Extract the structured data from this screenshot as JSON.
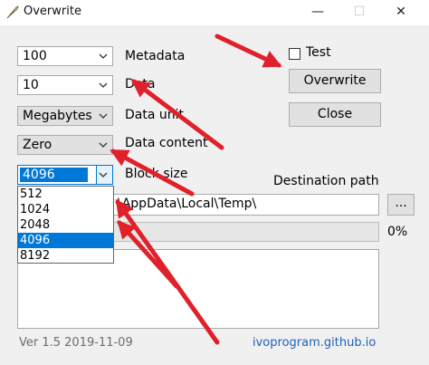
{
  "window": {
    "title": "Overwrite",
    "minimize": "—",
    "maximize": "☐",
    "close": "✕"
  },
  "metadata": {
    "value": "100",
    "label": "Metadata"
  },
  "data": {
    "value": "10",
    "label": "Data"
  },
  "data_unit": {
    "value": "Megabytes",
    "label": "Data unit"
  },
  "data_content": {
    "value": "Zero",
    "label": "Data content"
  },
  "block_size": {
    "value": "4096",
    "label": "Block size",
    "options": [
      "512",
      "1024",
      "2048",
      "4096",
      "8192"
    ],
    "selected_index": 3
  },
  "test": {
    "label": "Test",
    "checked": false
  },
  "buttons": {
    "overwrite": "Overwrite",
    "close": "Close",
    "browse": "..."
  },
  "destination": {
    "label": "Destination path",
    "value": "\\AppData\\Local\\Temp\\"
  },
  "progress": {
    "percent_label": "0%",
    "fraction": 0
  },
  "footer": {
    "version": "Ver 1.5 2019-11-09",
    "link": "ivoprogram.github.io"
  },
  "colors": {
    "accent": "#0078d7",
    "arrow": "#e0202a",
    "link": "#1f61b8"
  }
}
